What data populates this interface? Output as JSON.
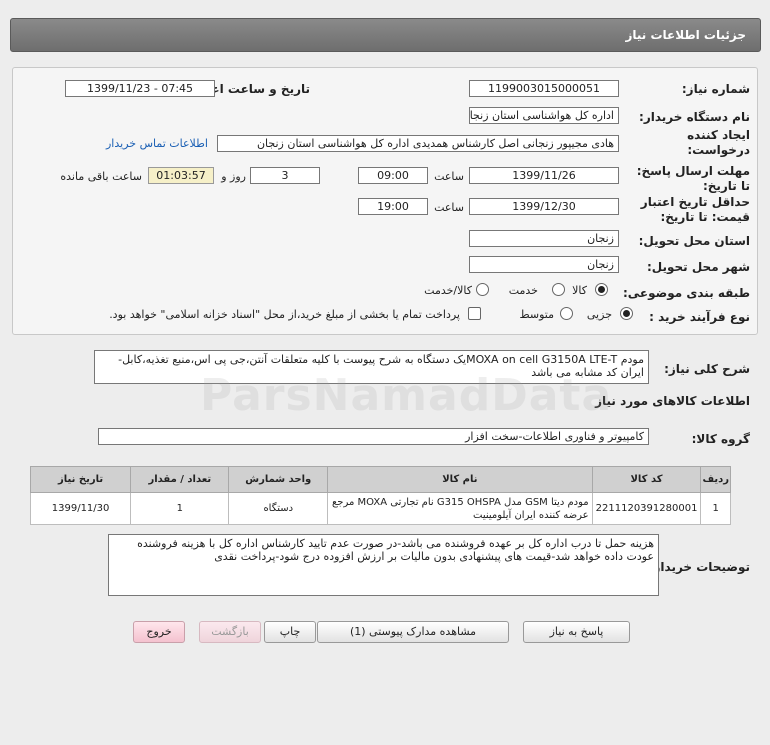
{
  "header": {
    "title": "جزئیات اطلاعات نیاز"
  },
  "form": {
    "need_number_label": "شماره نیاز:",
    "need_number": "1199003015000051",
    "announce_label": "تاریخ و ساعت اعلان عمومی:",
    "announce_value": "1399/11/23 - 07:45",
    "buyer_org_label": "نام دستگاه خریدار:",
    "buyer_org": "اداره کل هواشناسی استان زنجان",
    "creator_label_1": "ایجاد کننده",
    "creator_label_2": "درخواست:",
    "creator": "هادی مجیپور زنجانی اصل کارشناس همدیدی اداره کل هواشناسی استان زنجان",
    "contact_link": "اطلاعات تماس خریدار",
    "deadline_label_1": "مهلت ارسال پاسخ:",
    "deadline_label_2": "تا تاریخ:",
    "deadline_date": "1399/11/26",
    "time_label": "ساعت",
    "deadline_time": "09:00",
    "days_value": "3",
    "days_label": "روز و",
    "remaining_time": "01:03:57",
    "remaining_label": "ساعت باقی مانده",
    "validity_label_1": "حداقل تاریخ اعتبار",
    "validity_label_2": "قیمت: تا تاریخ:",
    "validity_date": "1399/12/30",
    "validity_time": "19:00",
    "province_label": "استان محل تحویل:",
    "province": "زنجان",
    "city_label": "شهر محل تحویل:",
    "city": "زنجان",
    "category_label": "طبقه بندی موضوعی:",
    "category_options": [
      "کالا",
      "خدمت",
      "کالا/خدمت"
    ],
    "category_selected": "کالا",
    "process_label": "نوع فرآیند خرید :",
    "process_options": [
      "جزیی",
      "متوسط"
    ],
    "process_selected": "جزیی",
    "payment_note": "پرداخت تمام یا بخشی از مبلغ خرید،از محل \"اسناد خزانه اسلامی\" خواهد بود."
  },
  "description": {
    "label": "شرح کلی نیاز:",
    "text": "مودم MOXA on cell G3150A LTE-Tیک دستگاه به شرح پیوست با کلیه متعلقات آنتن،جی پی اس،منبع تغذیه،کابل-ایران کد مشابه می باشد"
  },
  "goods_section": {
    "title": "اطلاعات کالاهای مورد نیاز",
    "group_label": "گروه کالا:",
    "group_value": "کامپیوتر و فناوری اطلاعات-سخت افزار"
  },
  "table": {
    "headers": [
      "ردیف",
      "کد کالا",
      "نام کالا",
      "واحد شمارش",
      "تعداد / مقدار",
      "تاریخ نیاز"
    ],
    "rows": [
      {
        "index": "1",
        "code": "2211120391280001",
        "name": "مودم دیتا GSM مدل G315 OHSPA نام تجارتی MOXA مرجع عرضه کننده ایران آیلومینیت",
        "unit": "دستگاه",
        "qty": "1",
        "date": "1399/11/30"
      }
    ]
  },
  "buyer_notes": {
    "label": "توضیحات خریدار:",
    "text": "هزینه حمل تا درب اداره کل بر عهده فروشنده می باشد-در صورت عدم تایید کارشناس اداره کل با هزینه فروشنده عودت داده خواهد شد-قیمت های پیشنهادی بدون مالیات بر ارزش افزوده درج شود-پرداخت نقدی"
  },
  "buttons": {
    "respond": "پاسخ به نیاز",
    "attachments": "مشاهده مدارک پیوستی (1)",
    "print": "چاپ",
    "back": "بازگشت",
    "exit": "خروج"
  },
  "colors": {
    "header_bg": "#7a7a7a",
    "link": "#1a5fb4",
    "remaining_bg": "#f6f0c8",
    "exit_btn": "#f4c2cf"
  }
}
